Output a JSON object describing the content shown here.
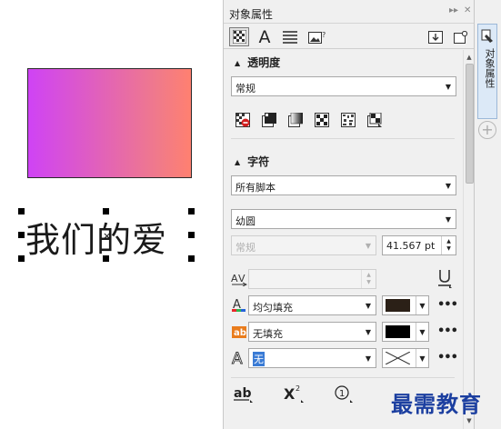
{
  "canvas": {
    "shape_gradient": {
      "from": "#cf43f5",
      "to": "#ff8070"
    },
    "selected_text": "我们的爱"
  },
  "panel": {
    "title": "对象属性",
    "tabs": [
      "fill-tab-icon",
      "character-tab-icon",
      "paragraph-tab-icon",
      "frame-tab-icon"
    ],
    "transparency": {
      "heading": "透明度",
      "mode": "常规",
      "type_icons": [
        "no-transparency-icon",
        "uniform-transparency-icon",
        "fountain-transparency-icon",
        "vector-pattern-icon",
        "bitmap-pattern-icon",
        "two-color-pattern-icon"
      ]
    },
    "character": {
      "heading": "字符",
      "script": "所有脚本",
      "font": "幼圆",
      "style": "常规",
      "size": "41.567 pt",
      "fill_type": "均匀填充",
      "fill_color": "#2b2017",
      "background_fill_type": "无填充",
      "background_color": "#000000",
      "outline_width": "无"
    }
  },
  "side_tab": {
    "label": "对象属性"
  },
  "watermark": "最需教育"
}
